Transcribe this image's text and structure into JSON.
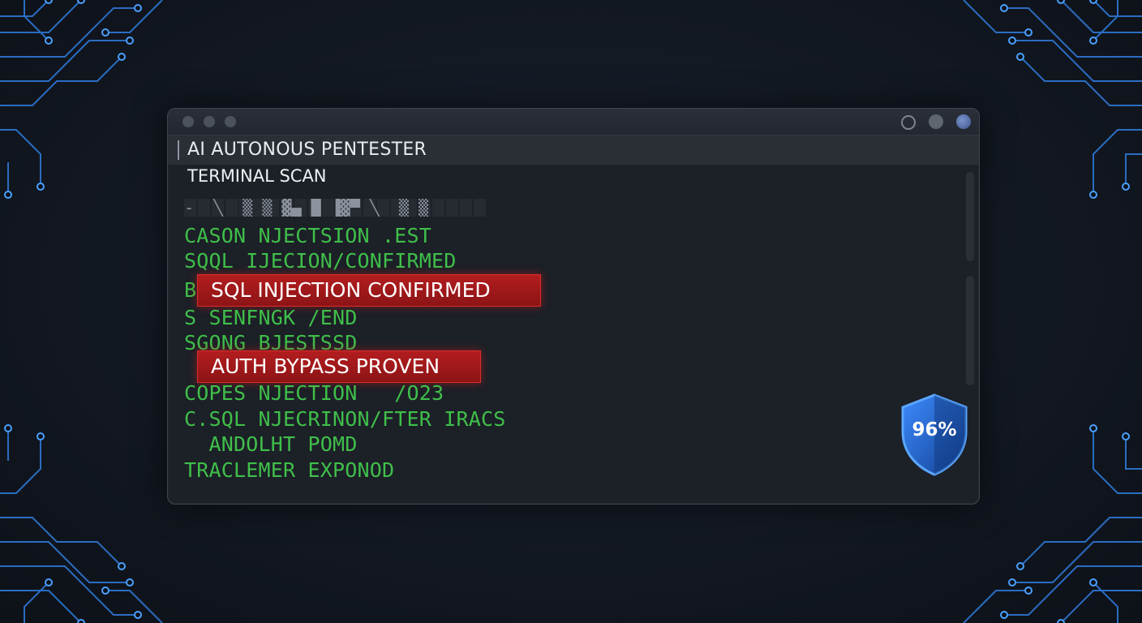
{
  "window": {
    "title": "AI AUTONOUS PENTESTER",
    "subtitle": "TERMINAL SCAN",
    "noise_text": "-  ╲  ▒ ▒ ▓▄ █ ▐▓▀ ╲  ▒ ▒"
  },
  "log": {
    "lines": [
      "CASON NJECTSION .EST",
      "SQQL IJECION/CONFIRMED",
      "BE",
      "S SENFNGK /END",
      "SGONG BJESTSSD",
      "COPES NJECTION   /O23",
      "C.SQL NJECRINON/FTER IRACS",
      "  ANDOLHT POMD",
      "TRACLEMER EXPONOD"
    ]
  },
  "alerts": {
    "sql": "SQL INJECTION CONFIRMED",
    "auth": "AUTH BYPASS PROVEN"
  },
  "score": {
    "value": "96%",
    "icon": "shield-icon"
  },
  "colors": {
    "terminal_green": "#3fbf4a",
    "alert_red": "#b31d1f",
    "shield_blue": "#1f63c9",
    "circuit_blue": "#3b8cff"
  }
}
